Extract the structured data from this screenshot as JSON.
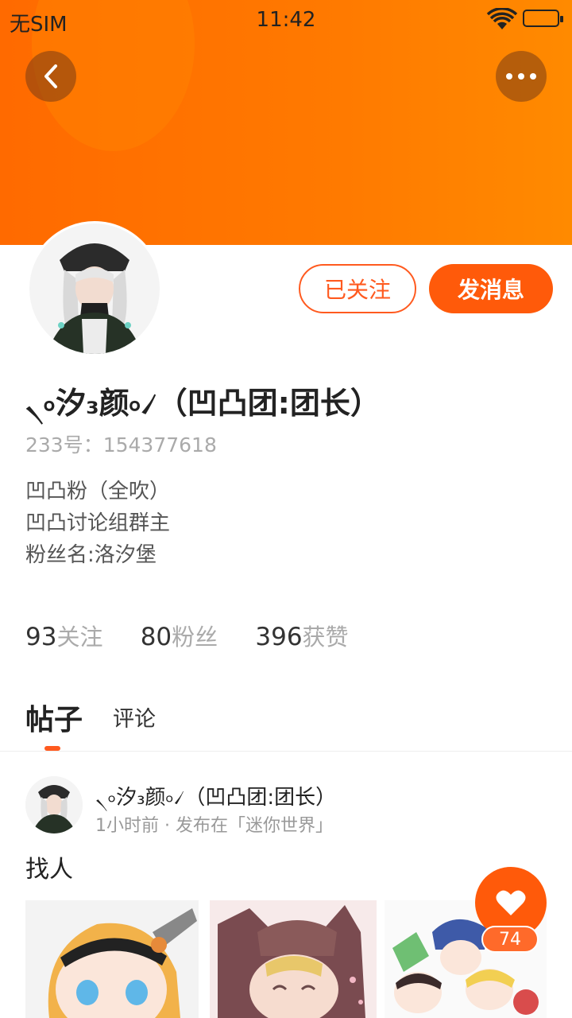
{
  "status_bar": {
    "carrier": "无SIM",
    "time": "11:42",
    "icons": [
      "wifi-icon",
      "battery-icon"
    ]
  },
  "header": {
    "back_icon": "chevron-left-icon",
    "more_icon": "more-horizontal-icon"
  },
  "profile": {
    "avatar_icon": "avatar-image",
    "follow_label": "已关注",
    "message_label": "发消息",
    "name": "৲৹汐₃颜৹৴（凹凸团:团长）",
    "uid": "233号：154377618",
    "bio": [
      "凹凸粉（全吹）",
      "凹凸讨论组群主",
      "粉丝名:洛汐堡"
    ],
    "stats": [
      {
        "num": "93",
        "label": "关注"
      },
      {
        "num": "80",
        "label": "粉丝"
      },
      {
        "num": "396",
        "label": "获赞"
      }
    ]
  },
  "tabs": {
    "active": "帖子",
    "other": "评论"
  },
  "post": {
    "author": "৲৹汐₃颜৹৴（凹凸团:团长）",
    "meta": "1小时前 · 发布在「迷你世界」",
    "text": "找人",
    "like_count": "74"
  },
  "colors": {
    "accent": "#ff5a1f",
    "header_orange": "#ff7a00"
  }
}
